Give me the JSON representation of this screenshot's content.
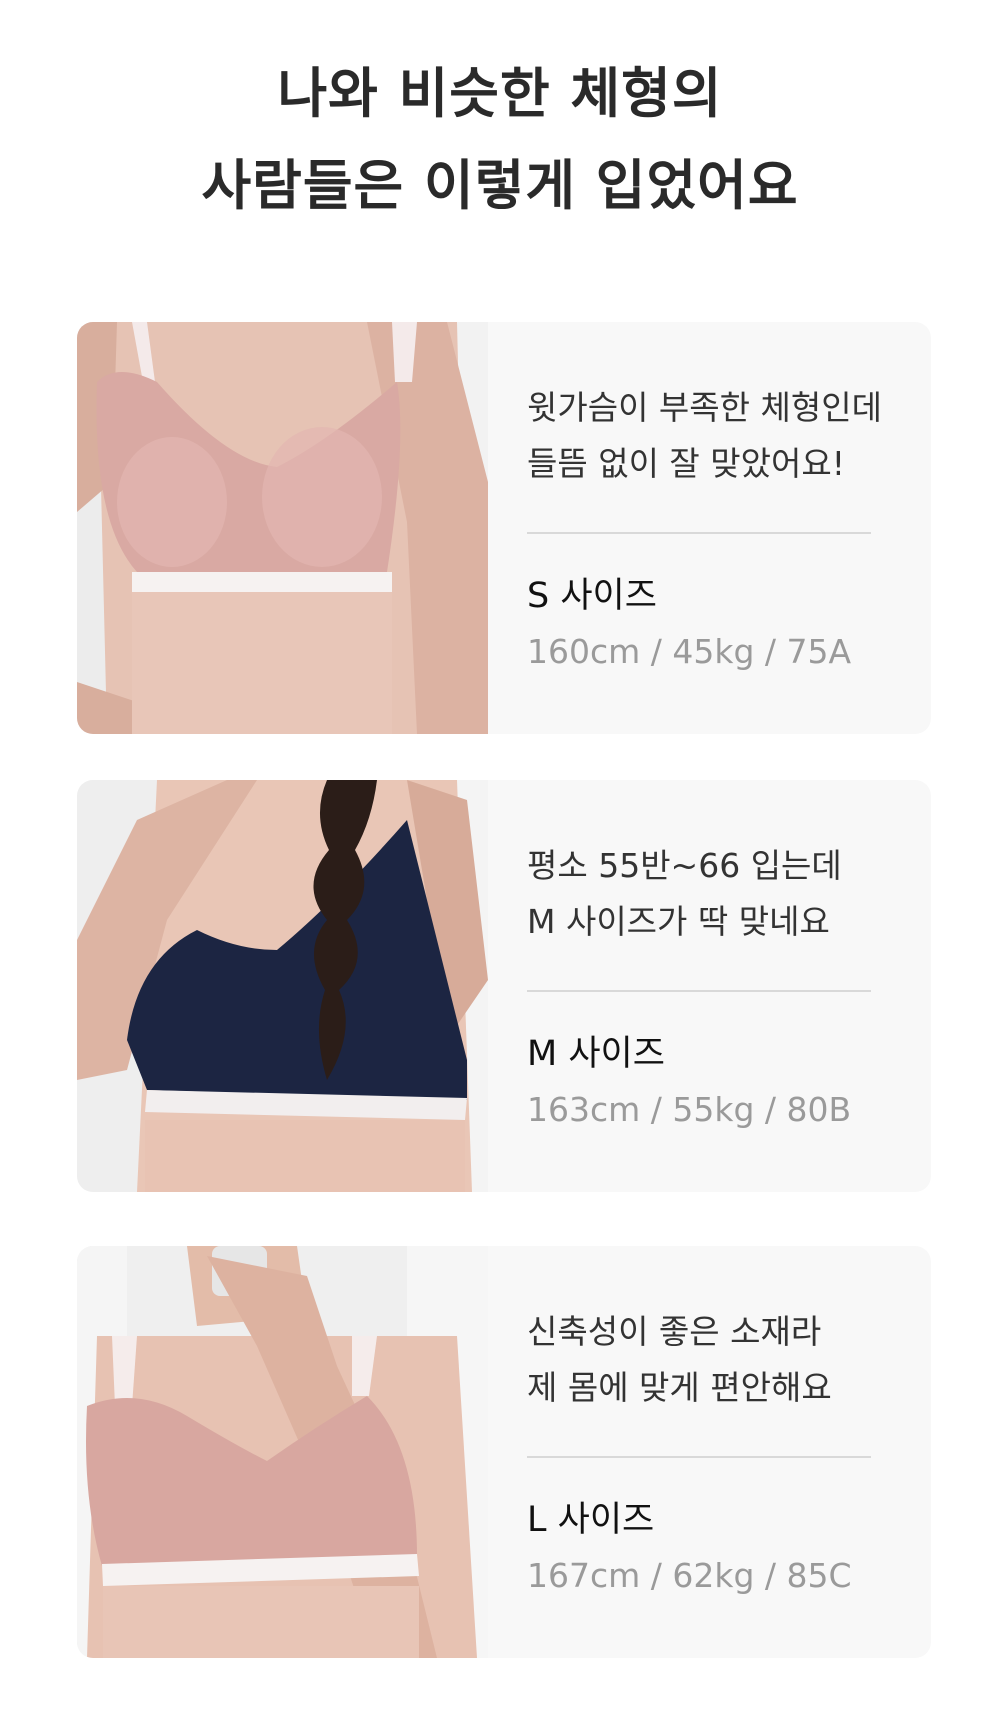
{
  "heading": {
    "line1": "나와 비슷한 체형의",
    "line2": "사람들은 이렇게 입었어요"
  },
  "cards": [
    {
      "photo_desc": "pink-bra-photo",
      "bra_color": "#d9a9a3",
      "review_line1": "윗가슴이 부족한 체형인데",
      "review_line2": "들뜸 없이 잘 맞았어요!",
      "size_label": "S 사이즈",
      "spec": "160cm / 45kg / 75A"
    },
    {
      "photo_desc": "navy-bra-photo",
      "bra_color": "#1c2542",
      "review_line1": "평소 55반~66 입는데",
      "review_line2": "M 사이즈가 딱 맞네요",
      "size_label": "M 사이즈",
      "spec": "163cm / 55kg / 80B"
    },
    {
      "photo_desc": "pink-bra-photo",
      "bra_color": "#d8a7a0",
      "review_line1": "신축성이 좋은 소재라",
      "review_line2": "제 몸에 맞게 편안해요",
      "size_label": "L 사이즈",
      "spec": "167cm / 62kg / 85C"
    }
  ]
}
